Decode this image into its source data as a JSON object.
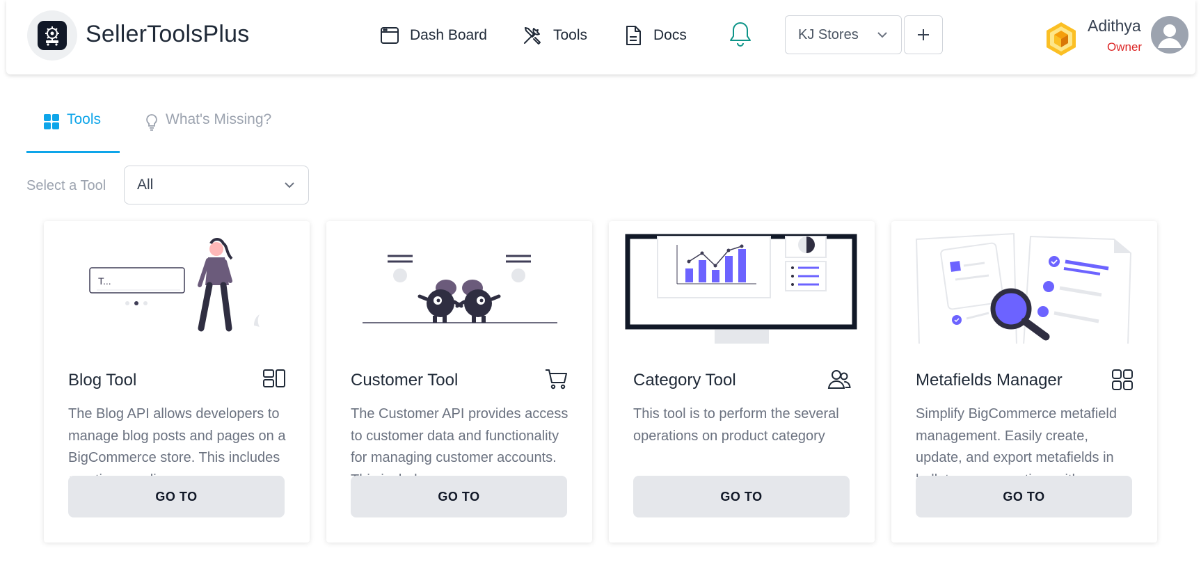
{
  "brand": {
    "name": "SellerToolsPlus",
    "logo_icon": "gear-cart-logo"
  },
  "nav": {
    "items": [
      {
        "label": "Dash Board",
        "icon": "browser-window-icon"
      },
      {
        "label": "Tools",
        "icon": "tools-icon"
      },
      {
        "label": "Docs",
        "icon": "document-icon"
      }
    ],
    "notification_icon": "bell-icon"
  },
  "store": {
    "selected": "KJ Stores",
    "add_icon": "plus-icon"
  },
  "user": {
    "name": "Adithya",
    "role": "Owner"
  },
  "tabs": [
    {
      "label": "Tools",
      "active": true,
      "icon": "grid-icon"
    },
    {
      "label": "What's Missing?",
      "active": false,
      "icon": "lightbulb-icon"
    }
  ],
  "tool_filter": {
    "label": "Select a Tool",
    "value": "All"
  },
  "cards": [
    {
      "title": "Blog Tool",
      "icon": "layout-icon",
      "description": "The Blog API allows developers to manage blog posts and pages on a BigCommerce store. This includes creating, reading...",
      "button": "GO TO",
      "illus_text": "T..."
    },
    {
      "title": "Customer Tool",
      "icon": "shopping-cart-icon",
      "description": "The Customer API provides access to customer data and functionality for managing customer accounts. This includes...",
      "button": "GO TO"
    },
    {
      "title": "Category Tool",
      "icon": "users-icon",
      "description": "This tool is to perform the several operations on product category",
      "button": "GO TO"
    },
    {
      "title": "Metafields Manager",
      "icon": "apps-grid-icon",
      "description": "Simplify BigCommerce metafield management. Easily create, update, and export metafields in bulk to save your time with...",
      "button": "GO TO"
    }
  ],
  "colors": {
    "accent": "#0ea5e9",
    "illustration": "#6c63ff",
    "role": "#dc2626",
    "bell": "#0d9488"
  }
}
